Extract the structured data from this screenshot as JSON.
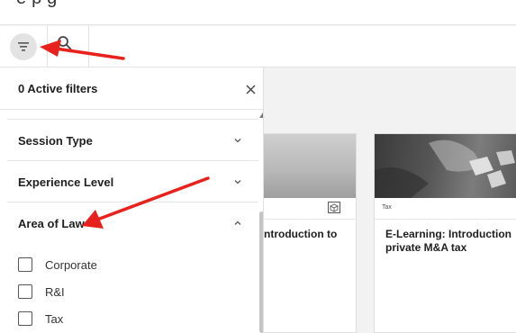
{
  "header": {
    "cut_title": "e  p          g"
  },
  "toolbar": {
    "filter_icon": "filter-icon",
    "search_icon": "search-icon"
  },
  "filter_panel": {
    "active_filters": "0 Active filters",
    "close_icon": "close-icon",
    "sections": [
      {
        "label": "Session Type",
        "state": "collapsed"
      },
      {
        "label": "Experience Level",
        "state": "collapsed"
      },
      {
        "label": "Area of Law",
        "state": "expanded"
      }
    ],
    "area_of_law_options": [
      {
        "label": "Corporate",
        "checked": false
      },
      {
        "label": "R&I",
        "checked": false
      },
      {
        "label": "Tax",
        "checked": false
      }
    ]
  },
  "cards": [
    {
      "tag": "",
      "title": "ntroduction to",
      "icon": "cube-icon"
    },
    {
      "tag": "Tax",
      "title": "E-Learning: Introduction private M&A tax"
    }
  ],
  "annotations": {
    "arrow_color": "#e8211c"
  }
}
